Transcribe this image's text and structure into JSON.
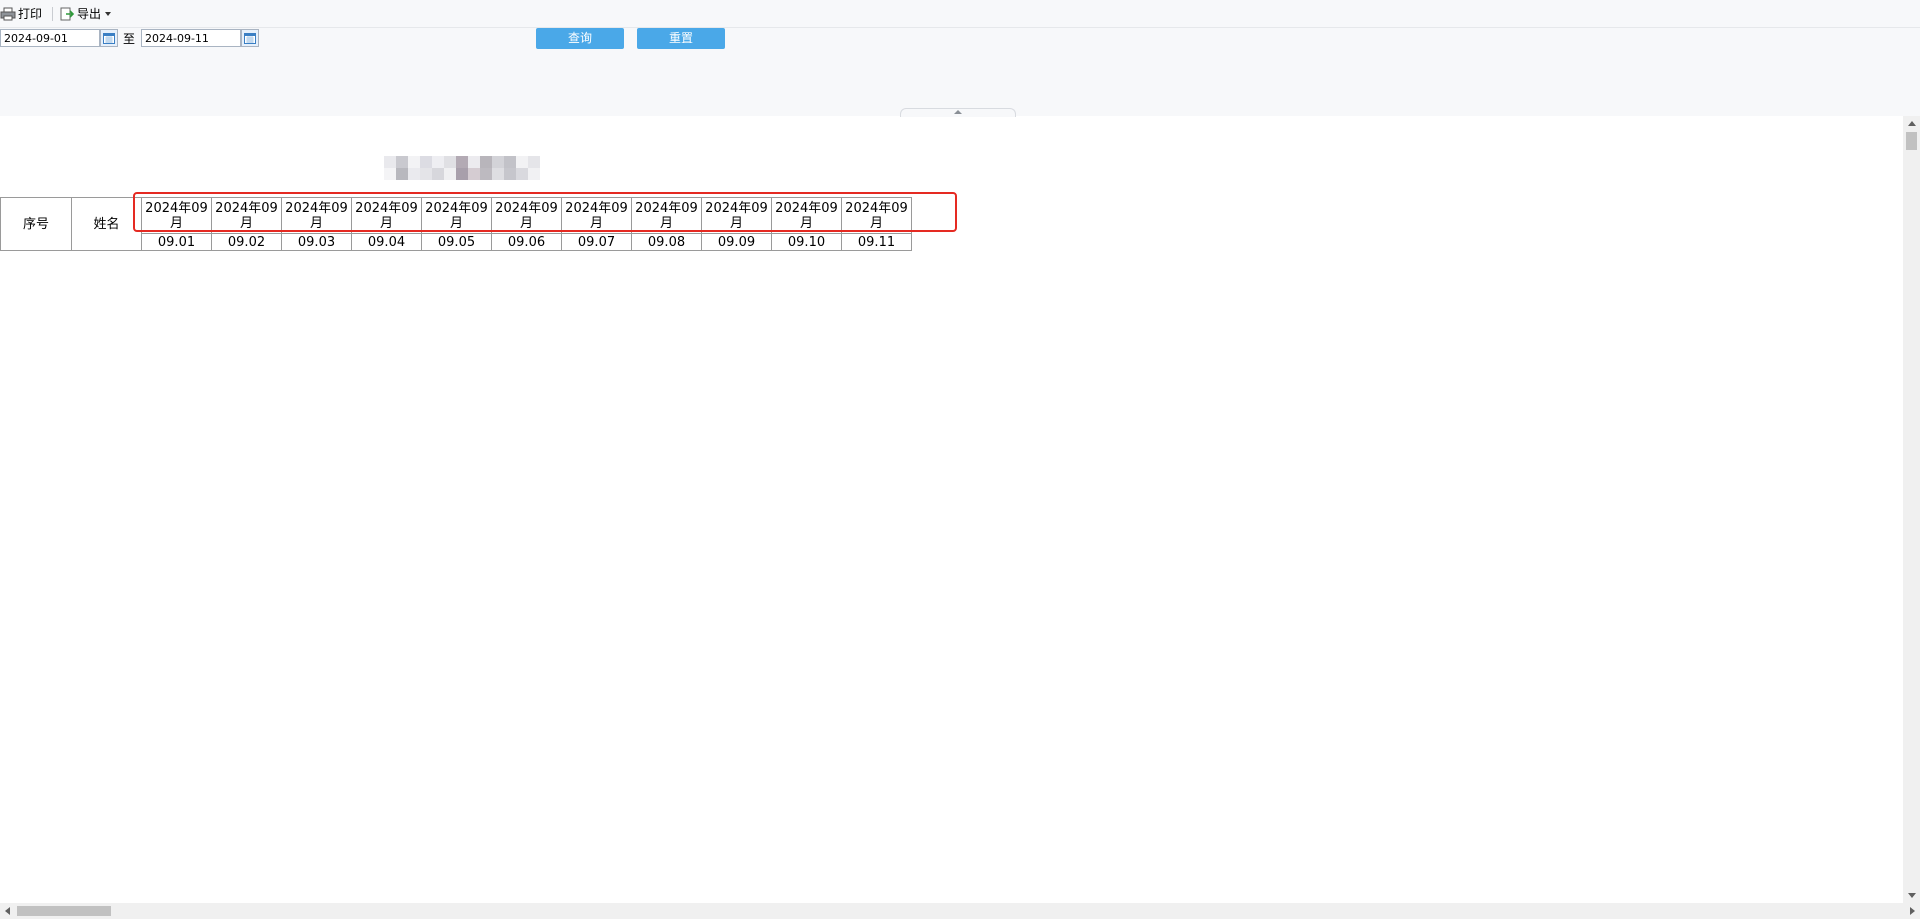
{
  "toolbar": {
    "print_label": "打印",
    "export_label": "导出"
  },
  "filters": {
    "start_date": "2024-09-01",
    "to_label": "至",
    "end_date": "2024-09-11",
    "query_label": "查询",
    "reset_label": "重置"
  },
  "table": {
    "seq_header": "序号",
    "name_header": "姓名",
    "month_header_line1": "2024年09",
    "month_header_line2": "月",
    "days": [
      "09.01",
      "09.02",
      "09.03",
      "09.04",
      "09.05",
      "09.06",
      "09.07",
      "09.08",
      "09.09",
      "09.10",
      "09.11"
    ]
  },
  "colors": {
    "button_blue": "#4aa8e8",
    "highlight_red": "#e52a22",
    "topbar_bg": "#f7f8fa"
  }
}
